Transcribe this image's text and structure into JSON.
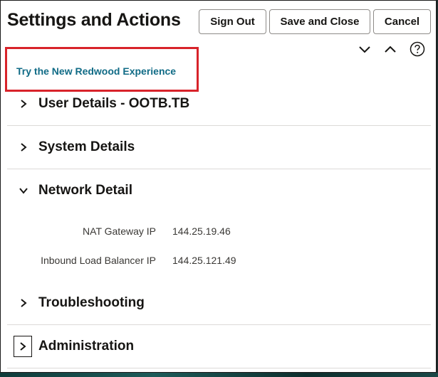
{
  "header": {
    "title": "Settings and Actions",
    "sign_out_label": "Sign Out",
    "save_close_label": "Save and Close",
    "cancel_label": "Cancel"
  },
  "toolbar": {
    "expand_all_icon": "chevron-down-icon",
    "collapse_all_icon": "chevron-up-icon",
    "help_icon": "help-circle-icon"
  },
  "redwood": {
    "link_label": "Try the New Redwood Experience",
    "link_color": "#106b86",
    "highlight_color": "#d8232a"
  },
  "sections": [
    {
      "label": "User Details - OOTB.TB",
      "expanded": false
    },
    {
      "label": "System Details",
      "expanded": false
    },
    {
      "label": "Network Detail",
      "expanded": true
    },
    {
      "label": "Troubleshooting",
      "expanded": false
    },
    {
      "label": "Administration",
      "expanded": false
    }
  ],
  "network_detail": {
    "rows": [
      {
        "label": "NAT Gateway IP",
        "value": "144.25.19.46"
      },
      {
        "label": "Inbound Load Balancer IP",
        "value": "144.25.121.49"
      }
    ]
  }
}
